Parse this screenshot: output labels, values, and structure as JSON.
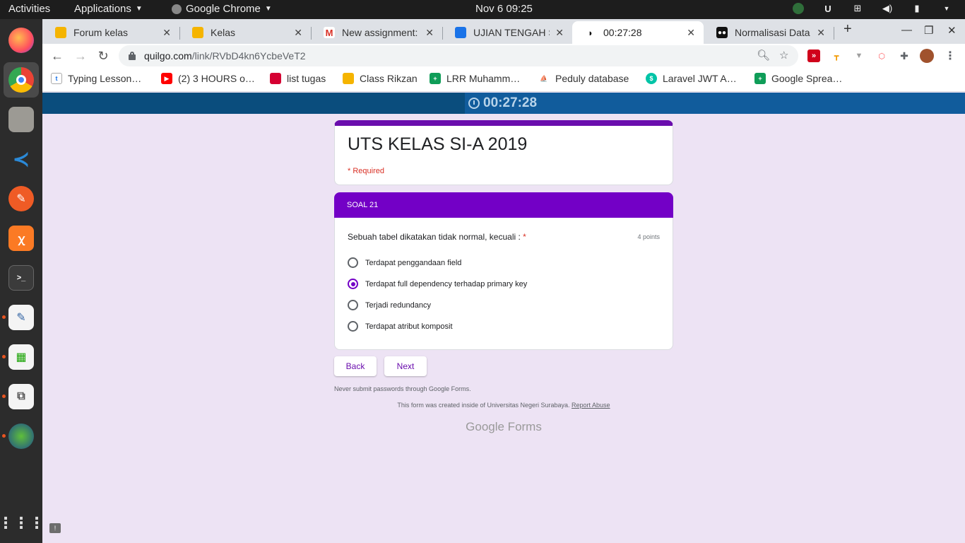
{
  "topbar": {
    "activities": "Activities",
    "applications": "Applications",
    "browser_name": "Google Chrome",
    "datetime": "Nov 6  09:25"
  },
  "tabs": [
    {
      "title": "Forum kelas",
      "active": false
    },
    {
      "title": "Kelas",
      "active": false
    },
    {
      "title": "New assignment:",
      "active": false
    },
    {
      "title": "UJIAN TENGAH SE",
      "active": false
    },
    {
      "title": "00:27:28",
      "active": true
    },
    {
      "title": "Normalisasi Data",
      "active": false
    }
  ],
  "address": {
    "domain": "quilgo.com",
    "path": "/link/RVbD4kn6YcbeVeT2"
  },
  "bookmarks": [
    "Typing Lesson…",
    "(2) 3 HOURS o…",
    "list tugas",
    "Class Rikzan",
    "LRR Muhamm…",
    "Peduly database",
    "Laravel JWT A…",
    "Google Sprea…"
  ],
  "timer": "00:27:28",
  "form": {
    "title": "UTS KELAS SI-A 2019",
    "required_note": "* Required",
    "section_title": "SOAL 21",
    "question": "Sebuah tabel dikatakan tidak normal, kecuali :",
    "required_star": "*",
    "points": "4 points",
    "options": [
      "Terdapat penggandaan field",
      "Terdapat full dependency terhadap primary key",
      "Terjadi redundancy",
      "Terdapat atribut komposit"
    ],
    "selected_option_index": 1,
    "back_label": "Back",
    "next_label": "Next",
    "password_note": "Never submit passwords through Google Forms.",
    "created_note": "This form was created inside of Universitas Negeri Surabaya.",
    "report_abuse": "Report Abuse",
    "logo_text": "Google Forms"
  },
  "colors": {
    "accent": "#7300c6",
    "timer_bar": "#115c9c",
    "page_bg": "#ede3f4"
  }
}
